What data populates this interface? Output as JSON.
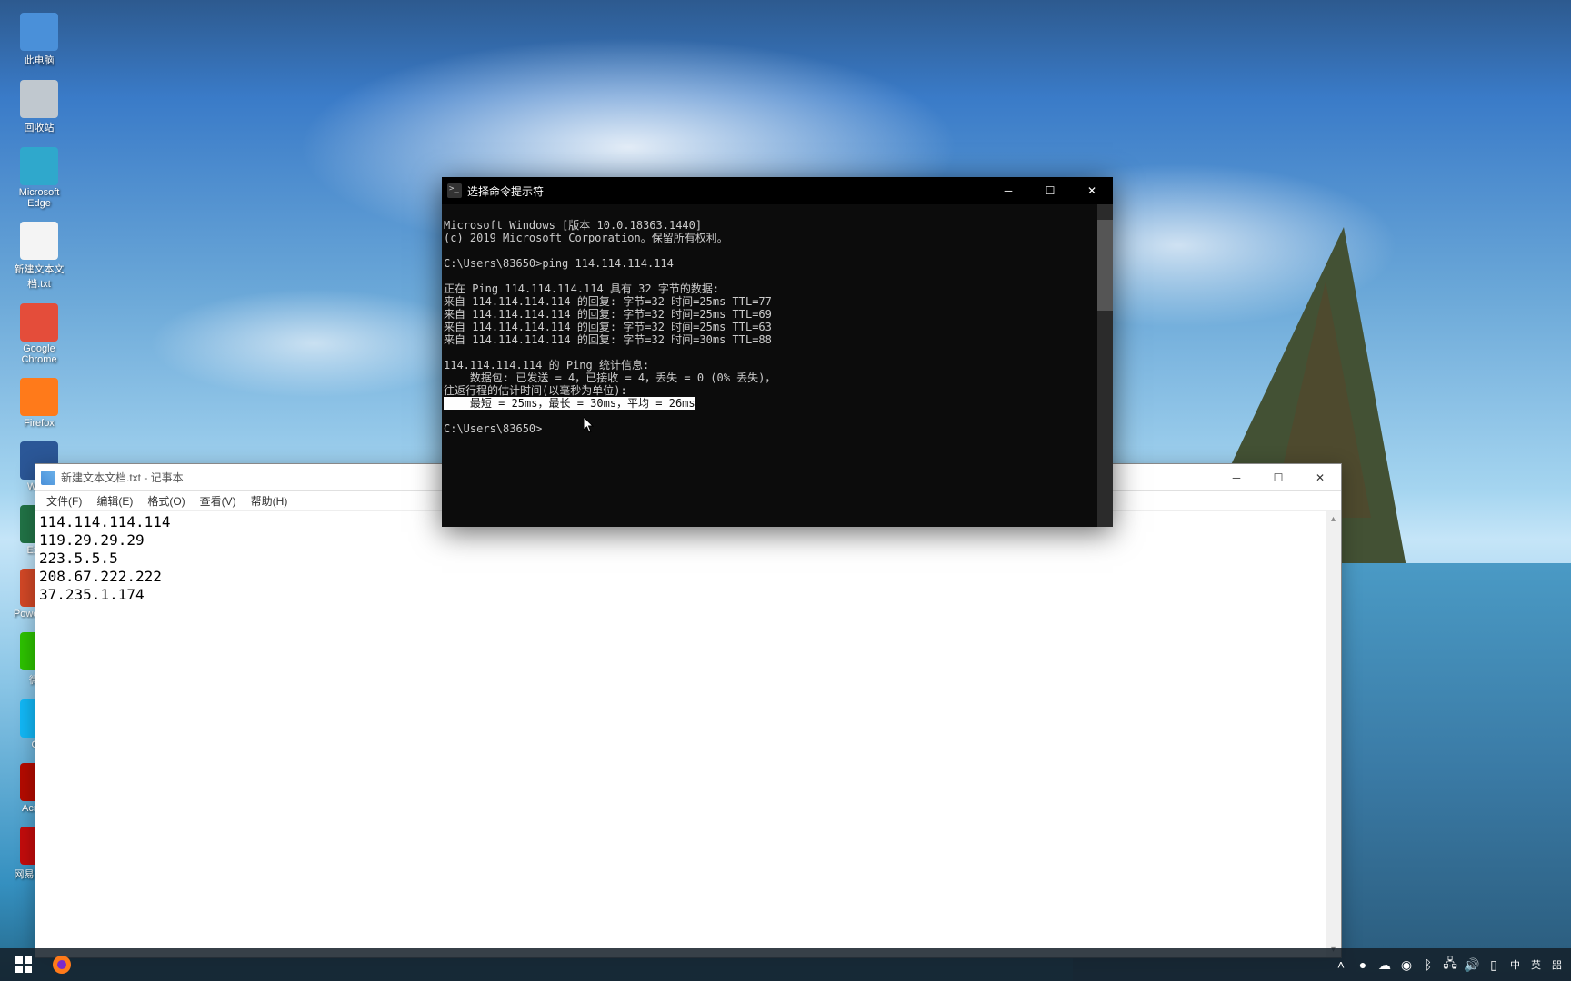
{
  "desktop_icons": [
    {
      "label": "此电脑",
      "color": "#4a90d9"
    },
    {
      "label": "回收站",
      "color": "#c0c8cf"
    },
    {
      "label": "Microsoft Edge",
      "color": "#2fa8cc"
    },
    {
      "label": "新建文本文档.txt",
      "color": "#f4f4f4"
    },
    {
      "label": "Google Chrome",
      "color": "#e44d3a"
    },
    {
      "label": "Firefox",
      "color": "#ff7a1a"
    },
    {
      "label": "Word",
      "color": "#2b5797"
    },
    {
      "label": "Excel",
      "color": "#217346"
    },
    {
      "label": "PowerPoint",
      "color": "#d24726"
    },
    {
      "label": "微信",
      "color": "#2dc100"
    },
    {
      "label": "QQ",
      "color": "#12b7f5"
    },
    {
      "label": "Acrobat",
      "color": "#b30b00"
    },
    {
      "label": "网易云音乐",
      "color": "#c20c0c"
    }
  ],
  "notepad": {
    "title": "新建文本文档.txt - 记事本",
    "menu": {
      "file": "文件(F)",
      "edit": "编辑(E)",
      "format": "格式(O)",
      "view": "查看(V)",
      "help": "帮助(H)"
    },
    "lines": [
      "114.114.114.114",
      "119.29.29.29",
      "223.5.5.5",
      "208.67.222.222",
      "37.235.1.174"
    ]
  },
  "cmd": {
    "title": "选择命令提示符",
    "l1": "Microsoft Windows [版本 10.0.18363.1440]",
    "l2": "(c) 2019 Microsoft Corporation。保留所有权利。",
    "prompt1": "C:\\Users\\83650>ping 114.114.114.114",
    "ping_header": "正在 Ping 114.114.114.114 具有 32 字节的数据:",
    "reply1": "来自 114.114.114.114 的回复: 字节=32 时间=25ms TTL=77",
    "reply2": "来自 114.114.114.114 的回复: 字节=32 时间=25ms TTL=69",
    "reply3": "来自 114.114.114.114 的回复: 字节=32 时间=25ms TTL=63",
    "reply4": "来自 114.114.114.114 的回复: 字节=32 时间=30ms TTL=88",
    "stats_header": "114.114.114.114 的 Ping 统计信息:",
    "stats_packets": "    数据包: 已发送 = 4，已接收 = 4，丢失 = 0 (0% 丢失)，",
    "rtt_header": "往返行程的估计时间(以毫秒为单位):",
    "rtt_values": "    最短 = 25ms，最长 = 30ms，平均 = 26ms",
    "prompt2": "C:\\Users\\83650>"
  },
  "taskbar": {
    "lang1": "中",
    "lang2": "英",
    "ime": "㗊"
  }
}
